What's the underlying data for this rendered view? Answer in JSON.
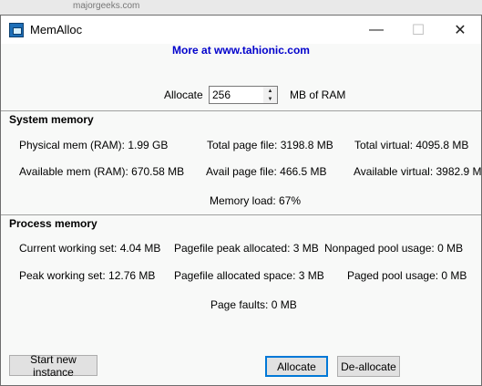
{
  "window": {
    "title": "MemAlloc",
    "minimize_glyph": "—",
    "maximize_glyph": "☐",
    "close_glyph": "✕"
  },
  "link": "More at www.tahionic.com",
  "allocate": {
    "label": "Allocate",
    "value": "256",
    "unit": "MB of RAM"
  },
  "system_memory": {
    "heading": "System memory",
    "physical_mem": "Physical mem (RAM): 1.99 GB",
    "total_page_file": "Total page file: 3198.8 MB",
    "total_virtual": "Total virtual: 4095.8 MB",
    "available_mem": "Available mem (RAM): 670.58 MB",
    "avail_page_file": "Avail page file: 466.5 MB",
    "available_virtual": "Available virtual: 3982.9 MB",
    "memory_load": "Memory load: 67%"
  },
  "process_memory": {
    "heading": "Process memory",
    "current_working_set": "Current working set: 4.04 MB",
    "pagefile_peak_allocated": "Pagefile peak allocated: 3 MB",
    "nonpaged_pool_usage": "Nonpaged pool usage: 0 MB",
    "peak_working_set": "Peak working set: 12.76 MB",
    "pagefile_allocated_space": "Pagefile allocated space: 3 MB",
    "paged_pool_usage": "Paged pool usage: 0 MB",
    "page_faults": "Page faults: 0 MB"
  },
  "buttons": {
    "start_new_instance": "Start new instance",
    "allocate": "Allocate",
    "deallocate": "De-allocate"
  },
  "background": {
    "url_fragment": "majorgeeks.com"
  },
  "colors": {
    "link": "#0000cc",
    "default_button_border": "#0078d7"
  }
}
